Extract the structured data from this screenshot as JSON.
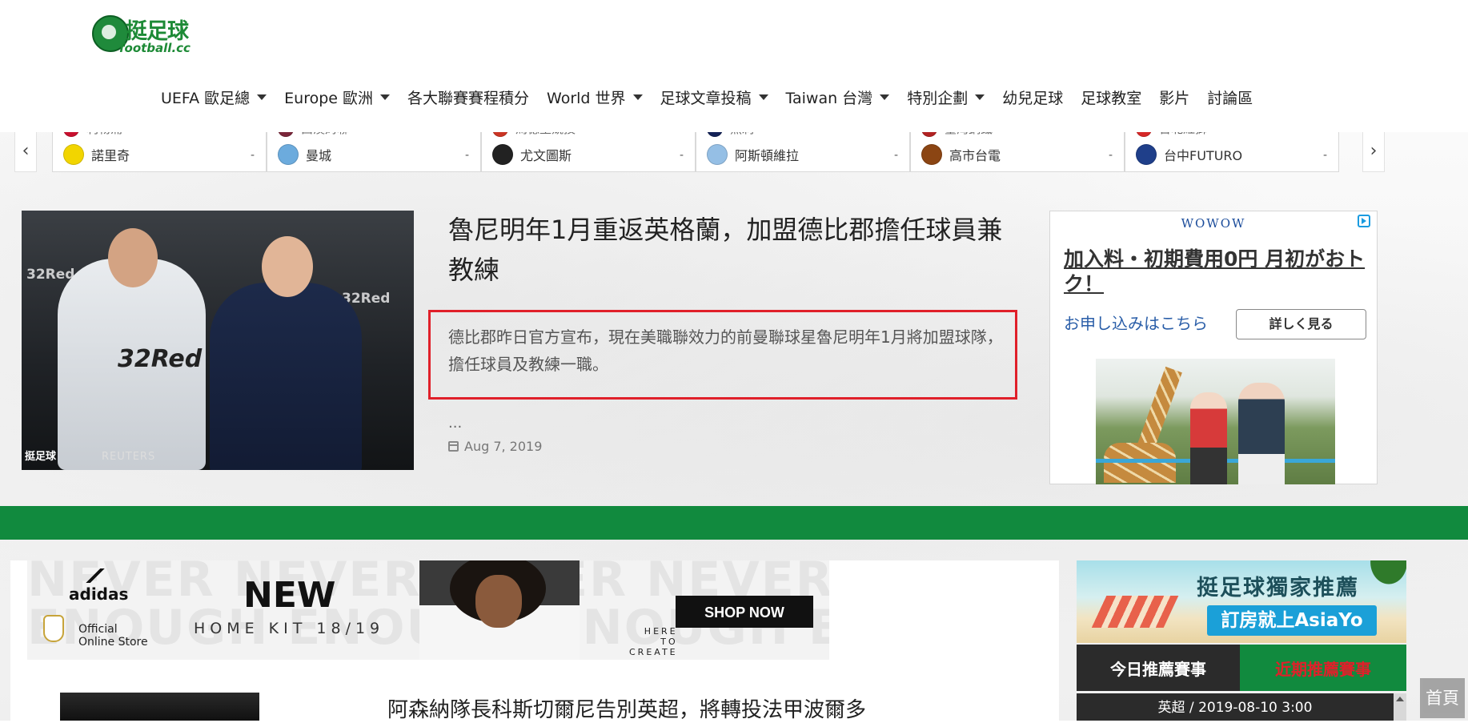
{
  "logo": {
    "cn": "挺足球",
    "en": "football.cc"
  },
  "nav": [
    {
      "label": "UEFA 歐足總",
      "dropdown": true
    },
    {
      "label": "Europe 歐洲",
      "dropdown": true
    },
    {
      "label": "各大聯賽賽程積分",
      "dropdown": false
    },
    {
      "label": "World 世界",
      "dropdown": true
    },
    {
      "label": "足球文章投稿",
      "dropdown": true
    },
    {
      "label": "Taiwan 台灣",
      "dropdown": true
    },
    {
      "label": "特別企劃",
      "dropdown": true
    },
    {
      "label": "幼兒足球",
      "dropdown": false
    },
    {
      "label": "足球教室",
      "dropdown": false
    },
    {
      "label": "影片",
      "dropdown": false
    },
    {
      "label": "討論區",
      "dropdown": false
    }
  ],
  "score_strip": {
    "prev": "‹",
    "next": "›",
    "matches": [
      {
        "team_top": "利物浦",
        "team": "諾里奇",
        "score": "-",
        "color_top": "#c8102e",
        "color": "#f2d500"
      },
      {
        "team_top": "西漢姆聯",
        "team": "曼城",
        "score": "-",
        "color_top": "#7a263a",
        "color": "#6cabdd"
      },
      {
        "team_top": "馬德里競技",
        "team": "尤文圖斯",
        "score": "-",
        "color_top": "#cb3524",
        "color": "#222222"
      },
      {
        "team_top": "熱刺",
        "team": "阿斯頓維拉",
        "score": "-",
        "color_top": "#132257",
        "color": "#95bfe5"
      },
      {
        "team_top": "臺灣鋼鐵",
        "team": "高市台電",
        "score": "-",
        "color_top": "#b22222",
        "color": "#8b4513"
      },
      {
        "team_top": "台北紅獅",
        "team": "台中FUTURO",
        "score": "-",
        "color_top": "#d62828",
        "color": "#1f3f8a"
      }
    ]
  },
  "feature": {
    "title": "魯尼明年1月重返英格蘭，加盟德比郡擔任球員兼教練",
    "excerpt": "德比郡昨日官方宣布，現在美職聯效力的前曼聯球星魯尼明年1月將加盟球隊，擔任球員及教練一職。",
    "ellipsis": "...",
    "date": "Aug 7, 2019",
    "image_text": {
      "sponsor": "32Red",
      "watermark": "挺足球",
      "credit": "REUTERS"
    }
  },
  "ad": {
    "brand": "WOWOW",
    "headline": "加入料・初期費用0円 月初がおトク！",
    "sub": "お申し込みはこちら",
    "cta": "詳しく見る"
  },
  "adidas": {
    "brand": "adidas",
    "store": [
      "Official",
      "Online Store"
    ],
    "new": "NEW",
    "kit": "HOME KIT 18/19",
    "here": [
      "HERE",
      "TO",
      "CREATE"
    ],
    "shop": "SHOP NOW"
  },
  "article2": {
    "title": "阿森納隊長科斯切爾尼告別英超，將轉投法甲波爾多"
  },
  "sidebar": {
    "banner_line1": "挺足球獨家推薦",
    "banner_line2": "訂房就上AsiaYo",
    "tab_today": "今日推薦賽事",
    "tab_recent": "近期推薦賽事",
    "match_info": "英超 / 2019-08-10 3:00"
  },
  "home_button": "首頁",
  "colors": {
    "brand_green": "#118a3e",
    "highlight_red": "#e0202a",
    "dark_tab": "#2b2b2b"
  }
}
